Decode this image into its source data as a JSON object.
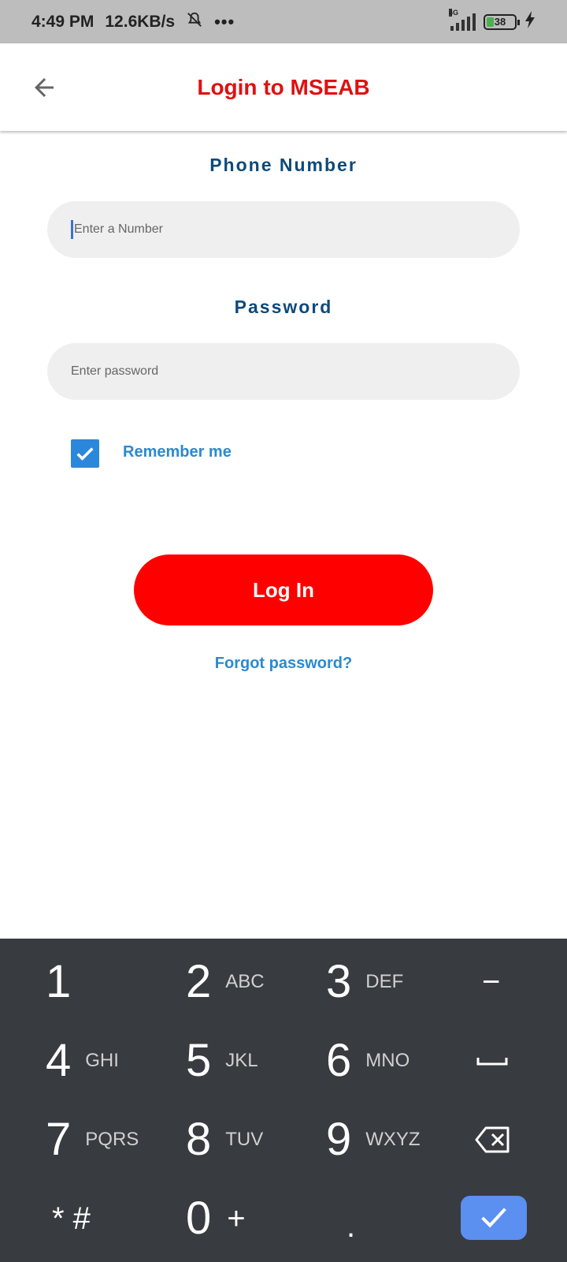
{
  "status_bar": {
    "time": "4:49 PM",
    "speed": "12.6KB/s",
    "network_type": "4G",
    "battery": "38"
  },
  "app_bar": {
    "title": "Login to MSEAB"
  },
  "form": {
    "phone_label": "Phone Number",
    "phone_placeholder": "Enter a Number",
    "password_label": "Password",
    "password_placeholder": "Enter password",
    "remember_label": "Remember me",
    "remember_checked": true,
    "login_label": "Log In",
    "forgot_label": "Forgot password?"
  },
  "keyboard": {
    "keys": [
      {
        "num": "1",
        "letters": ""
      },
      {
        "num": "2",
        "letters": "ABC"
      },
      {
        "num": "3",
        "letters": "DEF"
      },
      {
        "num": "−",
        "letters": ""
      },
      {
        "num": "4",
        "letters": "GHI"
      },
      {
        "num": "5",
        "letters": "JKL"
      },
      {
        "num": "6",
        "letters": "MNO"
      },
      {
        "num": "space",
        "letters": ""
      },
      {
        "num": "7",
        "letters": "PQRS"
      },
      {
        "num": "8",
        "letters": "TUV"
      },
      {
        "num": "9",
        "letters": "WXYZ"
      },
      {
        "num": "backspace",
        "letters": ""
      },
      {
        "num": "* #",
        "letters": ""
      },
      {
        "num": "0",
        "letters": "+"
      },
      {
        "num": ".",
        "letters": ""
      },
      {
        "num": "done",
        "letters": ""
      }
    ]
  },
  "colors": {
    "title": "#e01010",
    "label": "#0d4a7a",
    "link": "#2b8ad0",
    "login_button": "#ff0000",
    "keyboard_bg": "#383b3f",
    "done_key": "#5b8ff0"
  }
}
